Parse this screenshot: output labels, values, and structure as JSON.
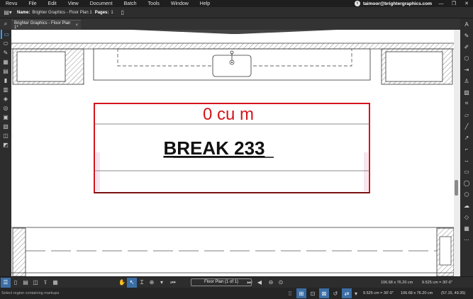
{
  "menu": [
    "Revu",
    "File",
    "Edit",
    "View",
    "Document",
    "Batch",
    "Tools",
    "Window",
    "Help"
  ],
  "user": {
    "email": "taimoor@brightergraphics.com",
    "initial": "t"
  },
  "docbar": {
    "name_label": "Name:",
    "name_value": "Brighter Graphics - Floor Plan 1",
    "pages_label": "Pages:",
    "pages_value": "1"
  },
  "tab": {
    "title": "Brighter Graphics - Floor Plan 1*",
    "close": "×"
  },
  "drawing": {
    "volume_label": "0 cu m",
    "room_label": "BREAK   233"
  },
  "nav": {
    "page_indicator": "Floor Plan (1 of 1)",
    "page_size": "106.68 x 76.20 cm",
    "scale": "9.525 cm = 30'-0\""
  },
  "status": {
    "message": "Select region containing markups",
    "scale": "9.525 cm = 30'-0\"",
    "page_size": "106.68 x 76.20 cm",
    "coords": "(57.15, 49.35)"
  },
  "colors": {
    "accent": "#3b9cff",
    "markup_red": "#d4141a",
    "markup_dark_red": "#7a1212"
  }
}
